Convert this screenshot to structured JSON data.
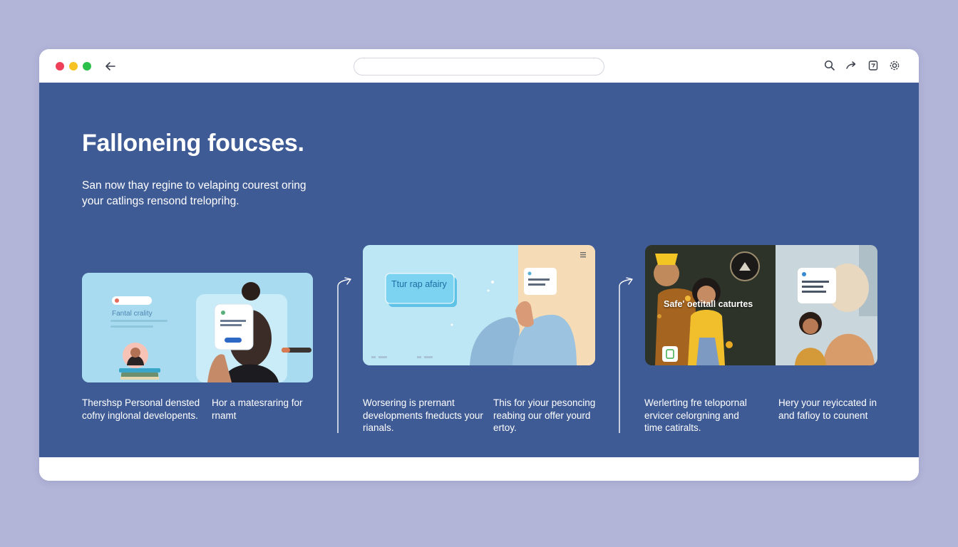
{
  "hero": {
    "title": "Falloneing foucses.",
    "subtitle": "San now thay regine to velaping courest oring your catlings rensond treloprihg."
  },
  "cards": [
    {
      "small_text": "Fantal crality",
      "columns": [
        "Thershsp Personal densted cofny inglonal developents.",
        "Hor a matesraring for rnamt"
      ]
    },
    {
      "tag_text": "Ttur rap afairy",
      "columns": [
        "Worsering is prernant developments fneducts your rianals.",
        "This for yiour pesoncing reabing our offer yourd ertoy."
      ]
    },
    {
      "overlay_text": "Safe' oetitall caturtes",
      "columns": [
        "Werlerting fre telopornal ervicer celorgning and time catiralts.",
        "Hery your reyiccated in and fafioy to counent"
      ]
    }
  ],
  "icons": {
    "back": "arrow-left-icon",
    "search": "search-icon",
    "share": "share-icon",
    "bookmark": "bookmark-icon",
    "settings": "gear-icon"
  },
  "colors": {
    "background": "#b2b5d8",
    "content": "#3f5b95",
    "accent": "#1e6fd0"
  }
}
